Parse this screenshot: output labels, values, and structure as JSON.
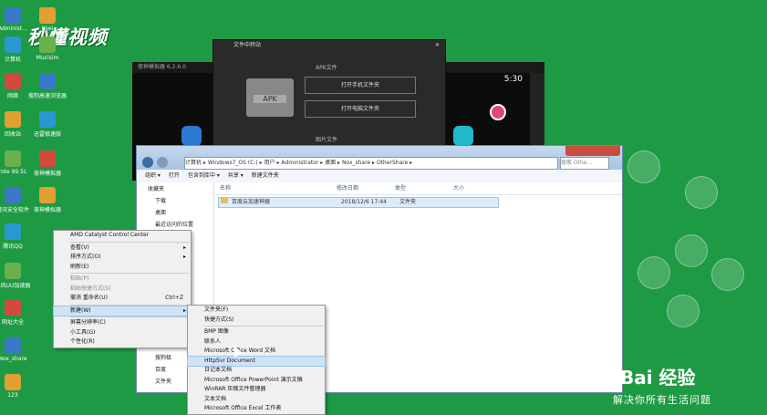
{
  "watermark": {
    "logo_text": "秒懂视频",
    "baidu": "Bai 经验",
    "baidu_sub": "解决你所有生活问题"
  },
  "desktop_icons": [
    {
      "label": "Administ…",
      "x_col": 0
    },
    {
      "label": "Ksei",
      "x_col": 1
    },
    {
      "label": "计算机",
      "x_col": 0
    },
    {
      "label": "Mucisim",
      "x_col": 1
    },
    {
      "label": "网络",
      "x_col": 0
    },
    {
      "label": "搜狗高速浏览器",
      "x_col": 1
    },
    {
      "label": "回收站",
      "x_col": 0
    },
    {
      "label": "迅雷极速版",
      "x_col": 1
    },
    {
      "label": "rote 99.5L",
      "x_col": 0
    },
    {
      "label": "夜神模拟器",
      "x_col": 1
    },
    {
      "label": "腾讯安全软件",
      "x_col": 0
    },
    {
      "label": "夜神模拟器",
      "x_col": 1
    },
    {
      "label": "腾讯QQ",
      "x_col": 0
    },
    {
      "label": "暴风UU加速器",
      "x_col": 0
    },
    {
      "label": "网址大全",
      "x_col": 0
    },
    {
      "label": "Nox_share",
      "x_col": 0
    },
    {
      "label": "123",
      "x_col": 0
    }
  ],
  "emulator": {
    "title": "夜神模拟器 6.2.6.0",
    "time": "5:30"
  },
  "transfer_dialog": {
    "title": "文件中转站",
    "apk_section": "APK文件",
    "apk_label": "APK",
    "open_phone_btn": "打开手机文件夹",
    "open_pc_btn": "打开电脑文件夹",
    "image_section": "图片文件"
  },
  "explorer": {
    "address": "计算机 ▸ Windows7_OS (C:) ▸ 用户 ▸ Administrator ▸ 桌面 ▸ Nox_share ▸ OtherShare ▸",
    "search_placeholder": "搜索 Othe…",
    "toolbar": [
      "组织 ▾",
      "打开",
      "包含到库中 ▾",
      "共享 ▾",
      "新建文件夹"
    ],
    "nav": [
      "收藏夹",
      "下载",
      "桌面",
      "最近访问的位置"
    ],
    "columns": [
      "名称",
      "修改日期",
      "类型",
      "大小"
    ],
    "file": {
      "name": "百度云加速神器",
      "date": "2018/12/6 17:44",
      "type": "文件夹"
    },
    "bottom_items": [
      "新加卷",
      "搜狗极",
      "百度",
      "文件夹"
    ]
  },
  "context_menu": {
    "items": [
      {
        "label": "AMD Catalyst Control Center",
        "arrow": false,
        "disabled": false
      },
      {
        "sep": true
      },
      {
        "label": "查看(V)",
        "arrow": true
      },
      {
        "label": "排序方式(O)",
        "arrow": true
      },
      {
        "label": "刷新(E)"
      },
      {
        "sep": true
      },
      {
        "label": "粘贴(P)",
        "disabled": true
      },
      {
        "label": "粘贴快捷方式(S)",
        "disabled": true
      },
      {
        "label": "撤消 重命名(U)",
        "shortcut": "Ctrl+Z"
      },
      {
        "sep": true
      },
      {
        "label": "新建(W)",
        "arrow": true,
        "highlight": true
      },
      {
        "sep": true
      },
      {
        "label": "屏幕分辨率(C)"
      },
      {
        "label": "小工具(G)"
      },
      {
        "label": "个性化(R)"
      }
    ]
  },
  "new_submenu": {
    "items": [
      {
        "label": "文件夹(F)"
      },
      {
        "label": "快捷方式(S)"
      },
      {
        "sep": true
      },
      {
        "label": "BMP 图像"
      },
      {
        "label": "联系人"
      },
      {
        "label": "Microsoft Office Word 文档"
      },
      {
        "label": "HttpSvr Document",
        "highlight": true
      },
      {
        "label": "日记本文档"
      },
      {
        "label": "Microsoft Office PowerPoint 演示文稿"
      },
      {
        "label": "WinRAR 压缩文件管理器"
      },
      {
        "label": "文本文档"
      },
      {
        "label": "Microsoft Office Excel 工作表"
      }
    ]
  }
}
